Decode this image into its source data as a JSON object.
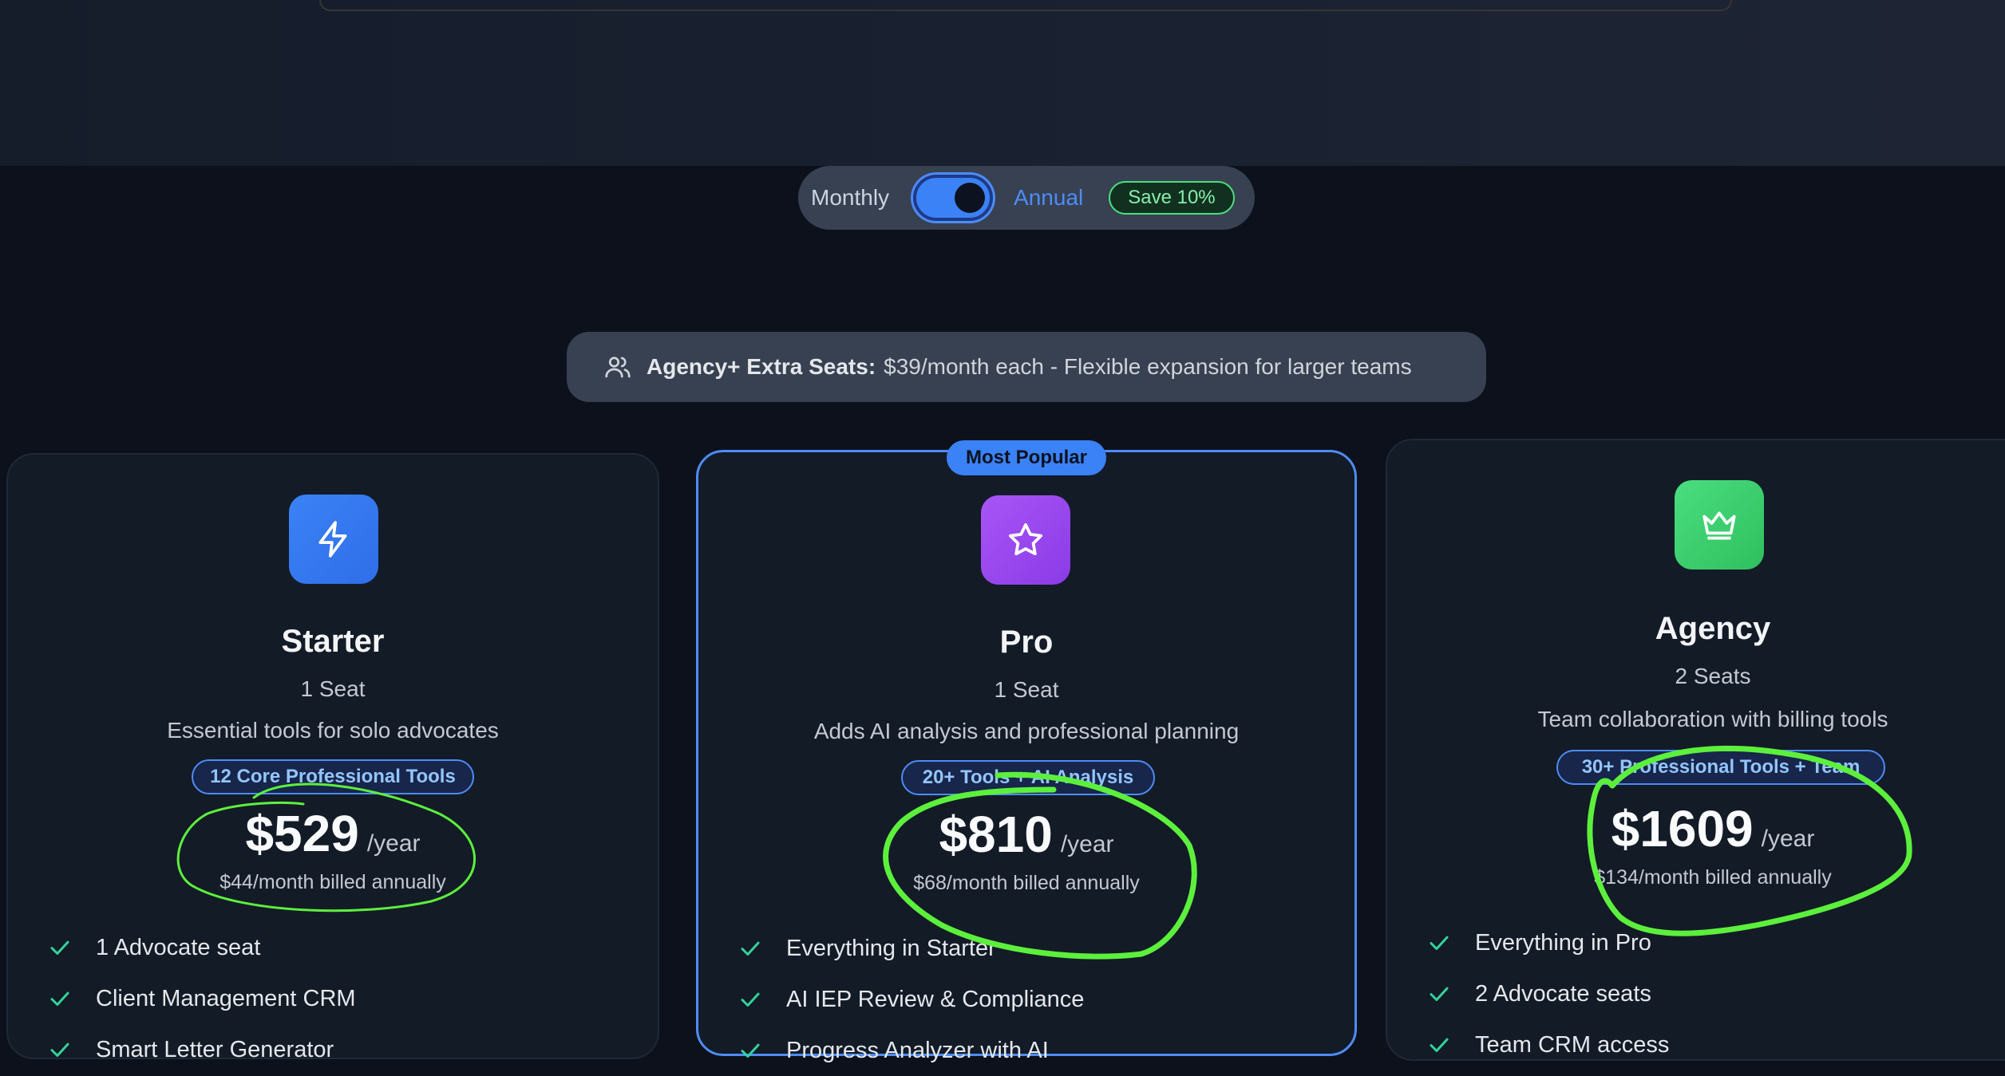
{
  "billing": {
    "monthly_label": "Monthly",
    "annual_label": "Annual",
    "save_badge": "Save 10%",
    "annual_selected": true
  },
  "extra_seats": {
    "title": "Agency+ Extra Seats:",
    "text": "$39/month each - Flexible expansion for larger teams",
    "icon": "users-icon"
  },
  "badge_most_popular": "Most Popular",
  "plans": [
    {
      "name": "Starter",
      "seats": "1 Seat",
      "description": "Essential tools for solo advocates",
      "tools_badge": "12 Core Professional Tools",
      "price": "$529",
      "period": "/year",
      "billed": "$44/month billed annually",
      "icon": "lightning-icon",
      "icon_color": "#3b82f6",
      "features": [
        "1 Advocate seat",
        "Client Management CRM",
        "Smart Letter Generator"
      ]
    },
    {
      "name": "Pro",
      "seats": "1 Seat",
      "description": "Adds AI analysis and professional planning",
      "tools_badge": "20+ Tools + AI Analysis",
      "price": "$810",
      "period": "/year",
      "billed": "$68/month billed annually",
      "icon": "star-icon",
      "icon_color": "#9333ea",
      "features": [
        "Everything in Starter",
        "AI IEP Review & Compliance",
        "Progress Analyzer with AI"
      ]
    },
    {
      "name": "Agency",
      "seats": "2 Seats",
      "description": "Team collaboration with billing tools",
      "tools_badge": "30+ Professional Tools + Team",
      "price": "$1609",
      "period": "/year",
      "billed": "$134/month billed annually",
      "icon": "crown-icon",
      "icon_color": "#22c55e",
      "features": [
        "Everything in Pro",
        "2 Advocate seats",
        "Team CRM access"
      ]
    }
  ],
  "colors": {
    "accent": "#3b82f6",
    "annotation": "#5cf03c",
    "check": "#34d399",
    "background": "#0c111b"
  }
}
